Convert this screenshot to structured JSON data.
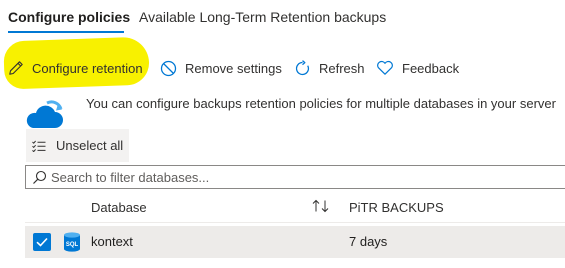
{
  "tabs": [
    {
      "label": "Configure policies",
      "active": true
    },
    {
      "label": "Available Long-Term Retention backups",
      "active": false
    }
  ],
  "toolbar": {
    "configure_label": "Configure retention",
    "remove_label": "Remove settings",
    "refresh_label": "Refresh",
    "feedback_label": "Feedback"
  },
  "info": {
    "text": "You can configure backups retention policies for multiple databases in your server"
  },
  "unselect": {
    "label": "Unselect all"
  },
  "search": {
    "placeholder": "Search to filter databases...",
    "value": ""
  },
  "table": {
    "columns": [
      "Database",
      "PiTR BACKUPS"
    ],
    "sort_icon": "up-down-arrows",
    "rows": [
      {
        "database": "kontext",
        "pitr": "7 days",
        "selected": true,
        "icon": "sql-database-icon"
      }
    ]
  },
  "colors": {
    "accent": "#0078d4",
    "highlight": "#f8f100",
    "row_selected": "#edebe9"
  }
}
